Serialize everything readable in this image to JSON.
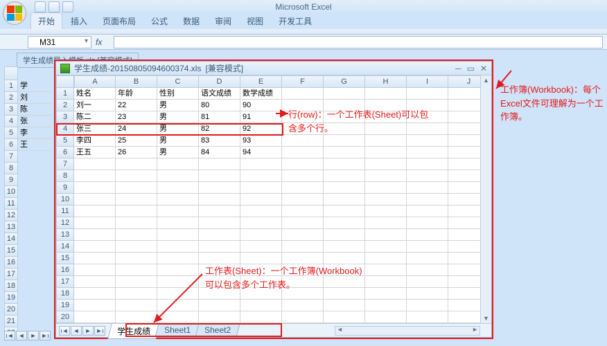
{
  "app_title": "Microsoft Excel",
  "ribbon": {
    "tabs": [
      "开始",
      "插入",
      "页面布局",
      "公式",
      "数据",
      "审阅",
      "视图",
      "开发工具"
    ]
  },
  "namebox": "M31",
  "fx": "fx",
  "bg_book": {
    "title": "学生成绩导入模板.xls [兼容模式]",
    "partial": [
      "学",
      "刘",
      "陈",
      "张",
      "李",
      "王"
    ]
  },
  "inner": {
    "filename": "学生成绩-20150805094600374.xls",
    "compat": "[兼容模式]",
    "columns": [
      "A",
      "B",
      "C",
      "D",
      "E",
      "F",
      "G",
      "H",
      "I",
      "J"
    ],
    "headers": [
      "姓名",
      "年龄",
      "性别",
      "语文成绩",
      "数学成绩"
    ],
    "data": [
      [
        "刘一",
        "22",
        "男",
        "80",
        "90"
      ],
      [
        "陈二",
        "23",
        "男",
        "81",
        "91"
      ],
      [
        "张三",
        "24",
        "男",
        "82",
        "92"
      ],
      [
        "李四",
        "25",
        "男",
        "83",
        "93"
      ],
      [
        "王五",
        "26",
        "男",
        "84",
        "94"
      ]
    ],
    "sheet_tabs": [
      "学生成绩",
      "Sheet1",
      "Sheet2"
    ]
  },
  "annot": {
    "workbook": "工作簿(Workbook)：每个Excel文件可理解为一个工作簿。",
    "row": "行(row)：一个工作表(Sheet)可以包含多个行。",
    "sheet": "工作表(Sheet)：一个工作簿(Workbook)可以包含多个工作表。"
  }
}
